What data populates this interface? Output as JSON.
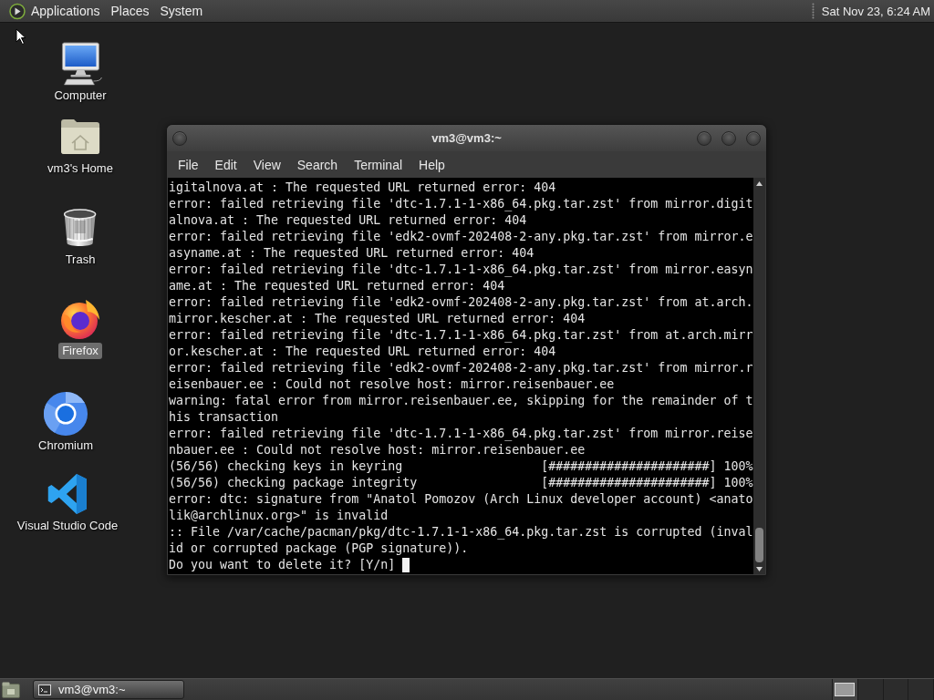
{
  "top_panel": {
    "menus": [
      "Applications",
      "Places",
      "System"
    ],
    "clock": "Sat Nov 23, 6:24 AM"
  },
  "desktop_icons": [
    {
      "kind": "computer",
      "label": "Computer",
      "selected": false
    },
    {
      "kind": "home",
      "label": "vm3's Home",
      "selected": false
    },
    {
      "kind": "trash",
      "label": "Trash",
      "selected": false
    },
    {
      "kind": "firefox",
      "label": "Firefox",
      "selected": true
    },
    {
      "kind": "chromium",
      "label": "Chromium",
      "selected": false
    },
    {
      "kind": "vscode",
      "label": "Visual Studio Code",
      "selected": false
    }
  ],
  "terminal": {
    "title": "vm3@vm3:~",
    "menu": [
      "File",
      "Edit",
      "View",
      "Search",
      "Terminal",
      "Help"
    ],
    "lines": [
      "igitalnova.at : The requested URL returned error: 404",
      "error: failed retrieving file 'dtc-1.7.1-1-x86_64.pkg.tar.zst' from mirror.digit",
      "alnova.at : The requested URL returned error: 404",
      "error: failed retrieving file 'edk2-ovmf-202408-2-any.pkg.tar.zst' from mirror.e",
      "asyname.at : The requested URL returned error: 404",
      "error: failed retrieving file 'dtc-1.7.1-1-x86_64.pkg.tar.zst' from mirror.easyn",
      "ame.at : The requested URL returned error: 404",
      "error: failed retrieving file 'edk2-ovmf-202408-2-any.pkg.tar.zst' from at.arch.",
      "mirror.kescher.at : The requested URL returned error: 404",
      "error: failed retrieving file 'dtc-1.7.1-1-x86_64.pkg.tar.zst' from at.arch.mirr",
      "or.kescher.at : The requested URL returned error: 404",
      "error: failed retrieving file 'edk2-ovmf-202408-2-any.pkg.tar.zst' from mirror.r",
      "eisenbauer.ee : Could not resolve host: mirror.reisenbauer.ee",
      "warning: fatal error from mirror.reisenbauer.ee, skipping for the remainder of t",
      "his transaction",
      "error: failed retrieving file 'dtc-1.7.1-1-x86_64.pkg.tar.zst' from mirror.reise",
      "nbauer.ee : Could not resolve host: mirror.reisenbauer.ee",
      "(56/56) checking keys in keyring                   [######################] 100%",
      "(56/56) checking package integrity                 [######################] 100%",
      "error: dtc: signature from \"Anatol Pomozov (Arch Linux developer account) <anato",
      "lik@archlinux.org>\" is invalid",
      ":: File /var/cache/pacman/pkg/dtc-1.7.1-1-x86_64.pkg.tar.zst is corrupted (inval",
      "id or corrupted package (PGP signature))."
    ],
    "prompt": "Do you want to delete it? [Y/n]",
    "cursor": true
  },
  "bottom_panel": {
    "tasks": [
      {
        "label": "vm3@vm3:~",
        "selected": false
      }
    ]
  }
}
